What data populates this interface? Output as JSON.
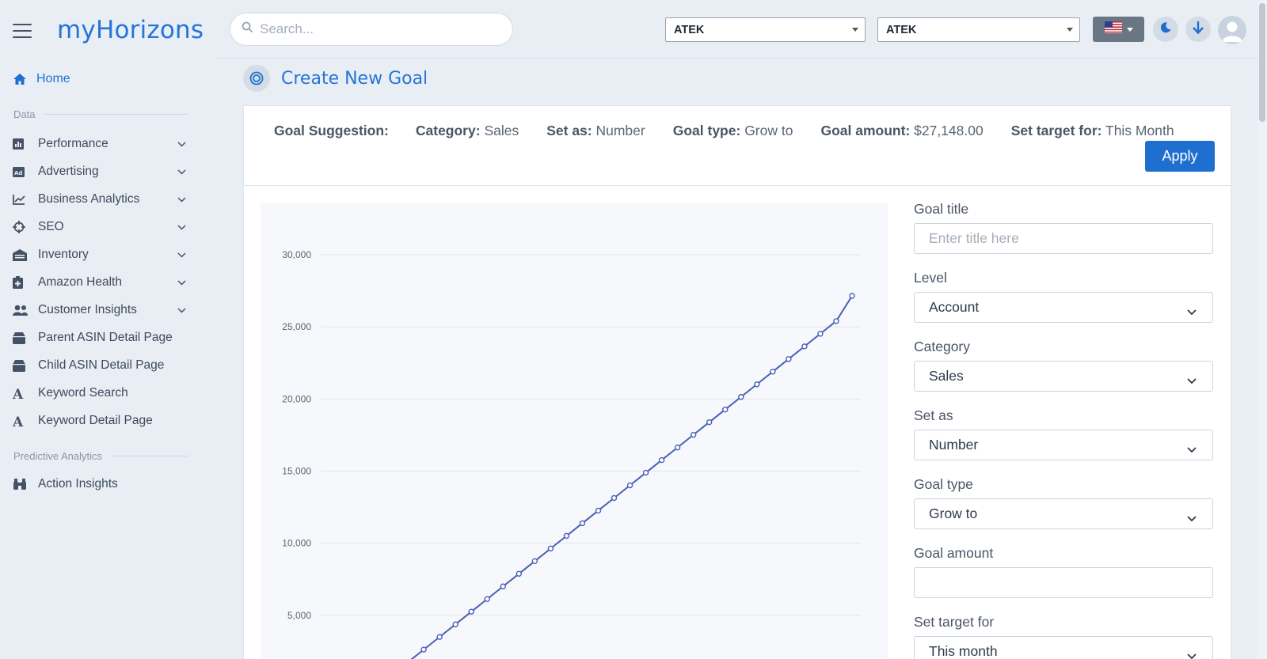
{
  "app": {
    "brand": "myHorizons"
  },
  "sidebar": {
    "home": "Home",
    "sections": {
      "data": "Data",
      "predictive": "Predictive Analytics"
    },
    "items": [
      {
        "label": "Performance",
        "icon": "bar-chart-icon"
      },
      {
        "label": "Advertising",
        "icon": "ad-icon"
      },
      {
        "label": "Business Analytics",
        "icon": "line-chart-icon"
      },
      {
        "label": "SEO",
        "icon": "crosshair-icon"
      },
      {
        "label": "Inventory",
        "icon": "warehouse-icon"
      },
      {
        "label": "Amazon Health",
        "icon": "clipboard-plus-icon"
      },
      {
        "label": "Customer Insights",
        "icon": "users-icon"
      },
      {
        "label": "Parent ASIN Detail Page",
        "icon": "box-icon"
      },
      {
        "label": "Child ASIN Detail Page",
        "icon": "box-icon"
      },
      {
        "label": "Keyword Search",
        "icon": "letter-a-icon"
      },
      {
        "label": "Keyword Detail Page",
        "icon": "letter-a-icon"
      }
    ],
    "predictive_items": [
      {
        "label": "Action Insights",
        "icon": "binoculars-icon"
      }
    ]
  },
  "topbar": {
    "search_placeholder": "Search...",
    "account_select_1": "ATEK",
    "account_select_2": "ATEK",
    "flag": "us-flag-icon"
  },
  "page": {
    "title": "Create New Goal"
  },
  "suggestion": {
    "lead": "Goal Suggestion:",
    "category_label": "Category:",
    "category_value": "Sales",
    "set_as_label": "Set as:",
    "set_as_value": "Number",
    "goal_type_label": "Goal type:",
    "goal_type_value": "Grow to",
    "amount_label": "Goal amount:",
    "amount_value": "$27,148.00",
    "target_label": "Set target for:",
    "target_value": "This Month",
    "apply_label": "Apply"
  },
  "form": {
    "goal_title_label": "Goal title",
    "goal_title_placeholder": "Enter title here",
    "level_label": "Level",
    "level_value": "Account",
    "category_label": "Category",
    "category_value": "Sales",
    "set_as_label": "Set as",
    "set_as_value": "Number",
    "goal_type_label": "Goal type",
    "goal_type_value": "Grow to",
    "goal_amount_label": "Goal amount",
    "goal_amount_value": "",
    "target_label": "Set target for",
    "target_value": "This month"
  },
  "colors": {
    "accent": "#1f6fd1",
    "line": "#4a5fb8"
  },
  "chart_data": {
    "type": "line",
    "ylim": [
      0,
      30000
    ],
    "y_ticks": [
      "5,000",
      "10,000",
      "15,000",
      "20,000",
      "25,000",
      "30,000"
    ],
    "y_tick_values": [
      5000,
      10000,
      15000,
      20000,
      25000,
      30000
    ],
    "x": [
      1,
      2,
      3,
      4,
      5,
      6,
      7,
      8,
      9,
      10,
      11,
      12,
      13,
      14,
      15,
      16,
      17,
      18,
      19,
      20,
      21,
      22,
      23,
      24,
      25,
      26,
      27,
      28,
      29,
      30,
      31
    ],
    "series": [
      {
        "values": [
          0,
          876,
          1752,
          2627,
          3503,
          4379,
          5255,
          6130,
          7006,
          7882,
          8758,
          9633,
          10509,
          11385,
          12261,
          13136,
          14012,
          14888,
          15764,
          16639,
          17515,
          18391,
          19267,
          20142,
          21018,
          21894,
          22770,
          23645,
          24521,
          25397,
          27148
        ]
      }
    ]
  }
}
